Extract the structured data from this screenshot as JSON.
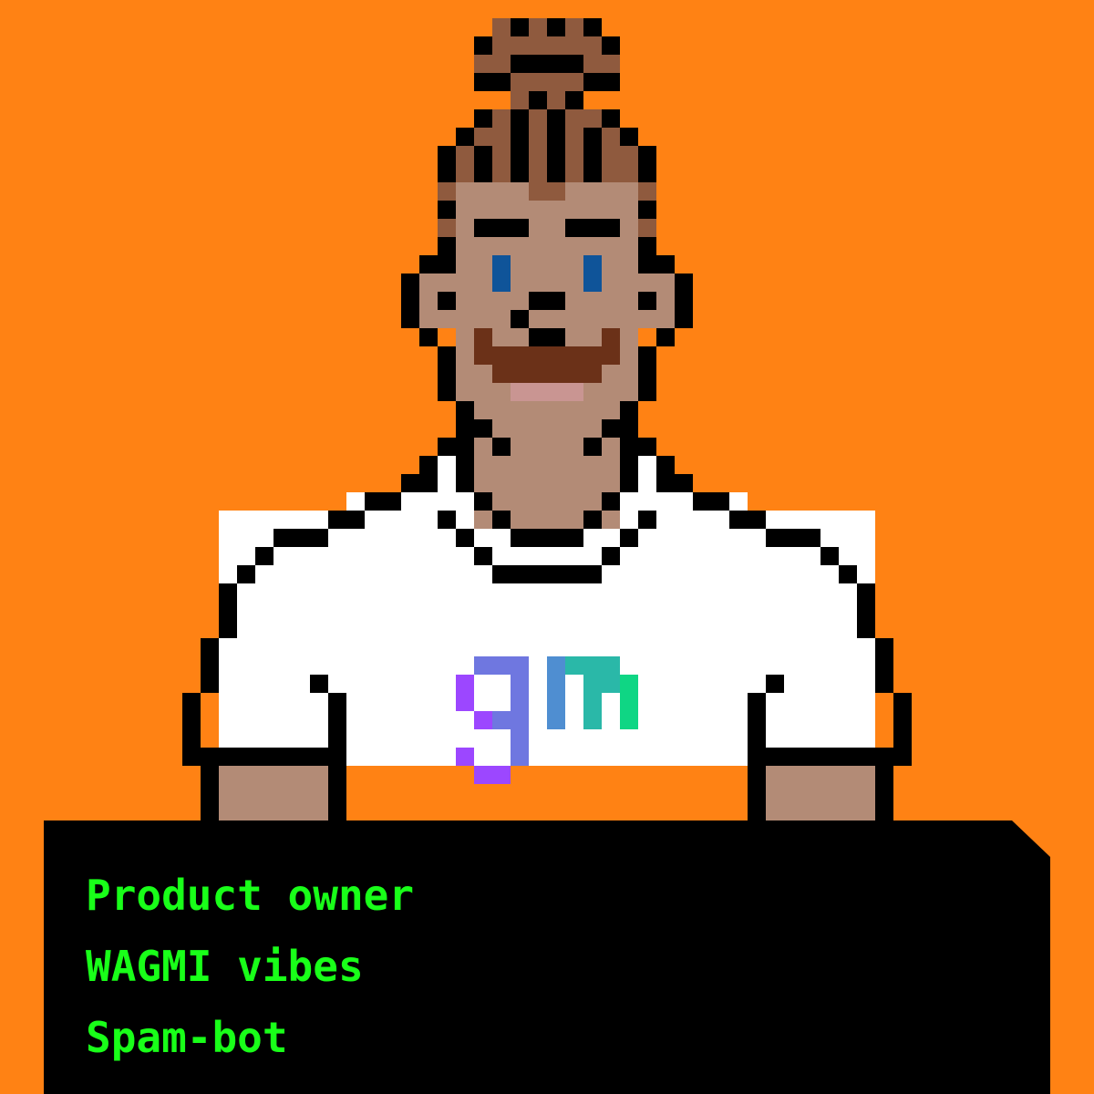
{
  "colors": {
    "background": "#ff8214",
    "panel": "#000000",
    "trait_text": "#19ff19",
    "outline": "#000000",
    "hair": "#8f5a3e",
    "skin": "#b38b76",
    "eyes": "#0f5499",
    "mustache": "#6b3118",
    "lip": "#c99592",
    "shirt": "#ffffff",
    "logo_gradient": [
      "#9c47ff",
      "#6f77e0",
      "#4f8ed1",
      "#2ab8a8",
      "#0fd684"
    ]
  },
  "character": {
    "logo_text": "gm"
  },
  "traits": {
    "role": "Product owner",
    "vibe": "WAGMI vibes",
    "special": "Spam-bot"
  }
}
